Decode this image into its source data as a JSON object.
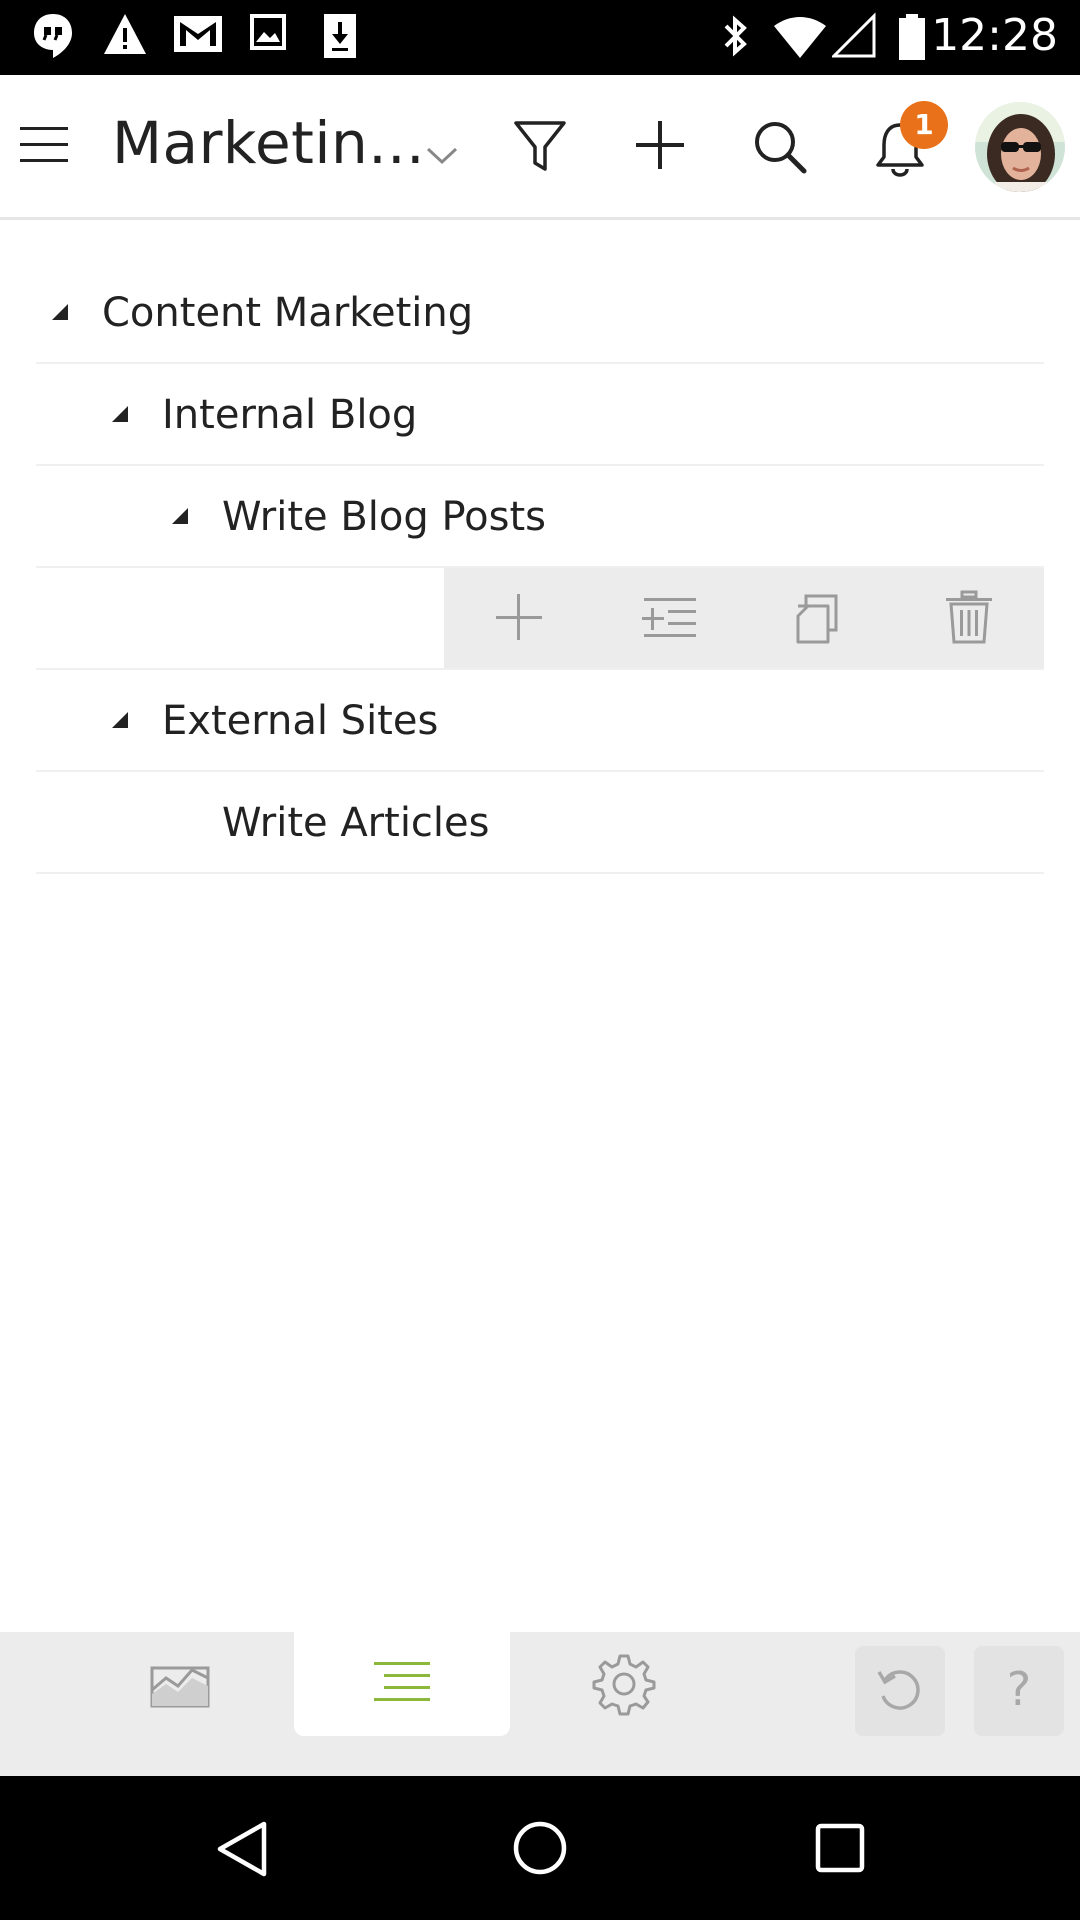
{
  "status_bar": {
    "time": "12:28",
    "icons": [
      "hangouts-icon",
      "warning-icon",
      "gmail-icon",
      "image-icon",
      "download-icon",
      "bluetooth-icon",
      "wifi-icon",
      "signal-icon",
      "battery-icon"
    ]
  },
  "app_bar": {
    "title": "Marketin...",
    "notification_count": "1",
    "icons": [
      "menu-icon",
      "chevron-down-icon",
      "filter-icon",
      "plus-icon",
      "search-icon",
      "bell-icon",
      "avatar"
    ]
  },
  "tree": {
    "rows": [
      {
        "label": "Content Marketing",
        "level": 0,
        "expanded": true
      },
      {
        "label": "Internal Blog",
        "level": 1,
        "expanded": true
      },
      {
        "label": "Write Blog Posts",
        "level": 2,
        "expanded": true
      },
      {
        "label": "External Sites",
        "level": 1,
        "expanded": true
      },
      {
        "label": "Write Articles",
        "level": 2,
        "expanded": false
      }
    ],
    "row_actions": [
      "add-icon",
      "add-subtask-icon",
      "duplicate-icon",
      "delete-icon"
    ]
  },
  "tab_bar": {
    "tabs": [
      "dashboard-icon",
      "list-icon",
      "settings-icon"
    ],
    "active_tab": "list-icon",
    "undo_icon": "undo-icon",
    "help_label": "?"
  },
  "colors": {
    "accent_green": "#8bb73a",
    "badge_orange": "#e8711a",
    "icon_gray": "#9a9a9a"
  }
}
